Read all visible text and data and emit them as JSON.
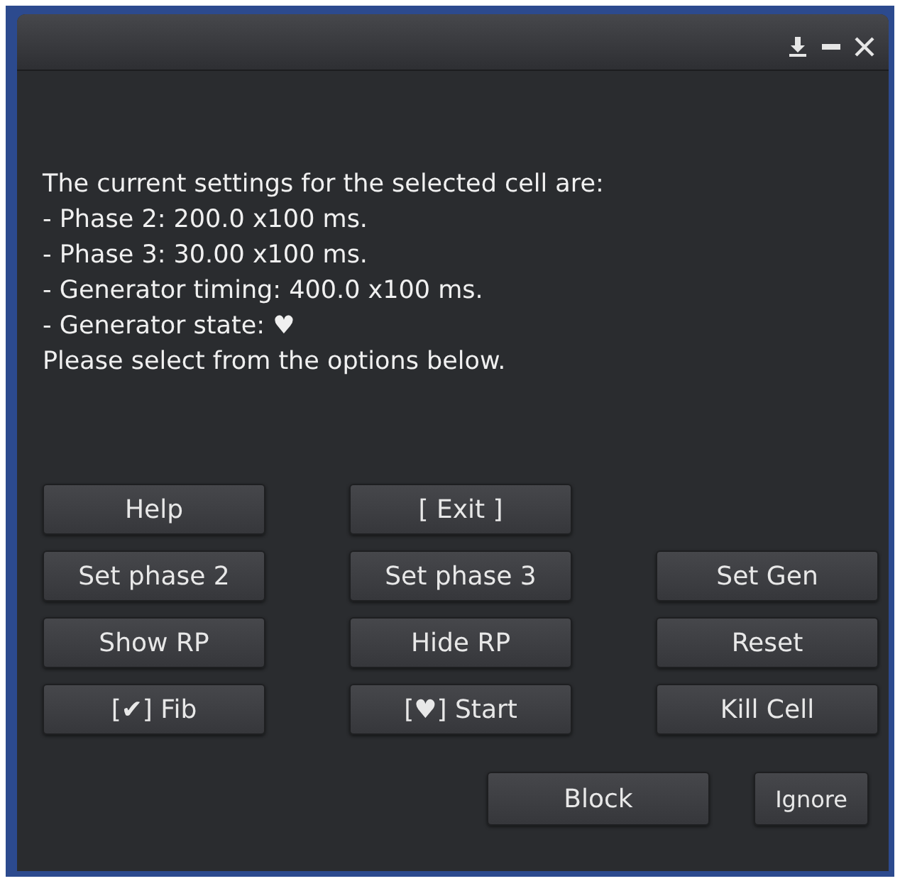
{
  "message": [
    "The current settings for the selected cell are:",
    "- Phase 2: 200.0 x100 ms.",
    "- Phase 3: 30.00 x100 ms.",
    "- Generator timing: 400.0 x100 ms.",
    "- Generator state: ♥",
    "Please select from the options below."
  ],
  "button_rows": [
    [
      "Help",
      "[ Exit ]"
    ],
    [
      "Set phase 2",
      "Set phase 3",
      "Set Gen"
    ],
    [
      "Show RP",
      "Hide RP",
      "Reset"
    ],
    [
      "[✔] Fib",
      "[♥] Start",
      "Kill Cell"
    ]
  ],
  "bottom_buttons": [
    "Block",
    "Ignore"
  ]
}
